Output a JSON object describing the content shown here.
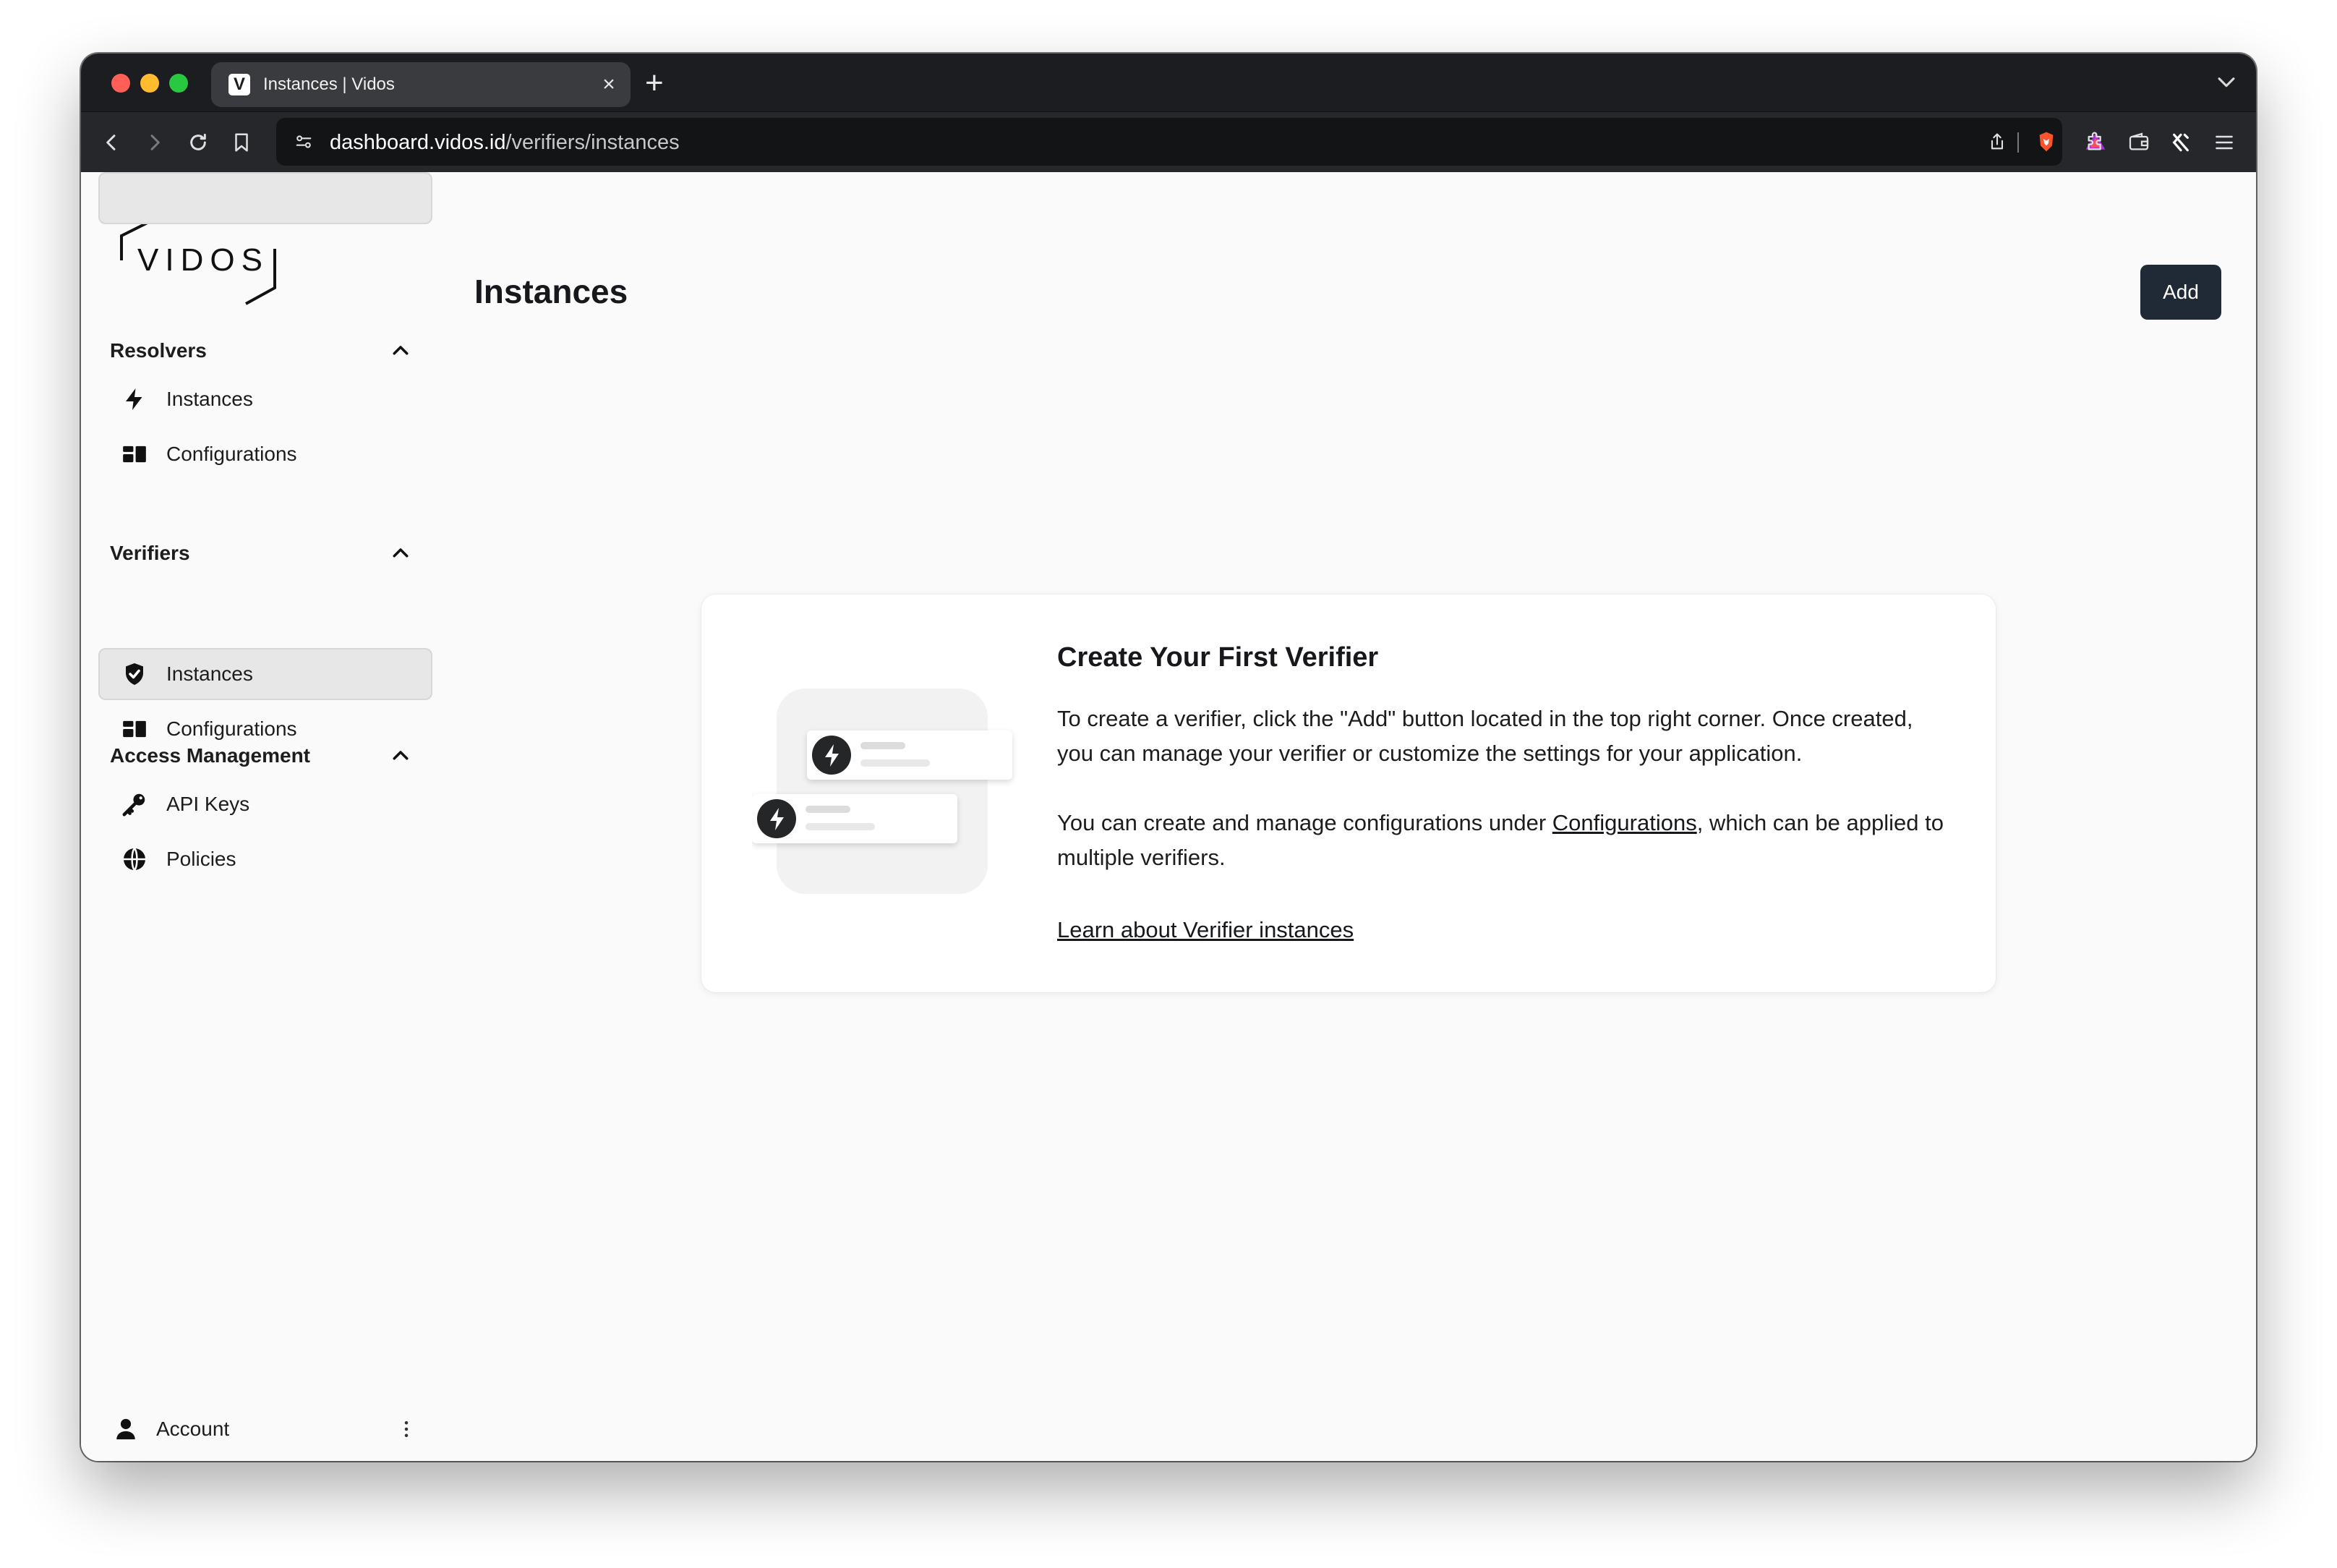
{
  "browser": {
    "tab_title": "Instances | Vidos",
    "tab_favicon_letter": "V",
    "address_host": "dashboard.vidos.id",
    "address_path": "/verifiers/instances"
  },
  "sidebar": {
    "logo_text": "VIDOS",
    "sections": [
      {
        "title": "Resolvers",
        "items": [
          {
            "label": "Instances",
            "icon": "lightning-icon"
          },
          {
            "label": "Configurations",
            "icon": "configurations-icon"
          }
        ]
      },
      {
        "title": "Verifiers",
        "items": [
          {
            "label": "Instances",
            "icon": "shield-check-icon",
            "active": true
          },
          {
            "label": "Configurations",
            "icon": "configurations-icon"
          }
        ]
      },
      {
        "title": "Access Management",
        "items": [
          {
            "label": "API Keys",
            "icon": "key-icon"
          },
          {
            "label": "Policies",
            "icon": "globe-icon"
          }
        ]
      }
    ],
    "account_label": "Account"
  },
  "main": {
    "title": "Instances",
    "add_label": "Add",
    "empty_state": {
      "title": "Create Your First Verifier",
      "p1": "To create a verifier, click the \"Add\" button located in the top right corner. Once created, you can manage your verifier or customize the settings for your application.",
      "p2_before": "You can create and manage configurations under ",
      "p2_link": "Configurations",
      "p2_after": ", which can be applied to multiple verifiers.",
      "learn_link": "Learn about Verifier instances"
    }
  },
  "colors": {
    "accent_button": "#1f2a36",
    "active_nav": "#e7e7e7",
    "chrome_dark": "#1c1d20"
  }
}
